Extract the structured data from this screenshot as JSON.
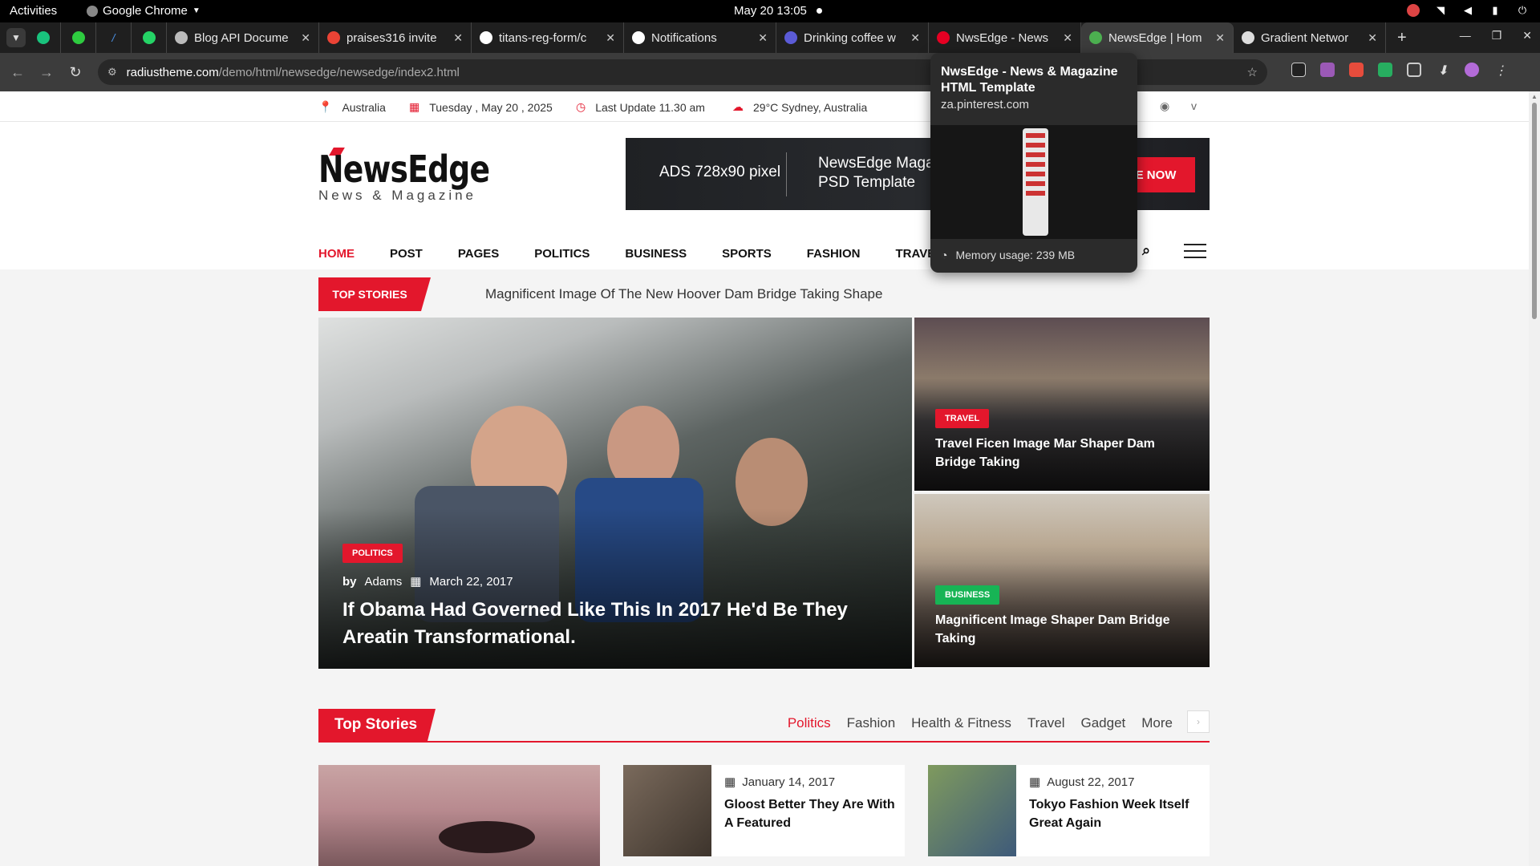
{
  "gnome": {
    "activities": "Activities",
    "app": "Google Chrome",
    "clock": "May 20  13:05"
  },
  "chrome": {
    "tabs": [
      {
        "title": "Blog API Docume",
        "fav_color": "#bbbbbb"
      },
      {
        "title": "praises316 invite",
        "fav_color": "#ea4335"
      },
      {
        "title": "titans-reg-form/c",
        "fav_color": "#ffffff"
      },
      {
        "title": "Notifications",
        "fav_color": "#ffffff"
      },
      {
        "title": "Drinking coffee w",
        "fav_color": "#5b5bd6"
      },
      {
        "title": "NwsEdge - News",
        "fav_color": "#e60023"
      },
      {
        "title": "NewsEdge | Hom",
        "fav_color": "#4caf50",
        "active": true
      },
      {
        "title": "Gradient Networ",
        "fav_color": "#dddddd"
      }
    ],
    "url_host": "radiustheme.com",
    "url_path": "/demo/html/newsedge/newsedge/index2.html",
    "hovercard": {
      "title": "NwsEdge - News & Magazine HTML Template",
      "url": "za.pinterest.com",
      "memory": "Memory usage: 239 MB"
    }
  },
  "site": {
    "topinfo": {
      "country": "Australia",
      "date": "Tuesday , May 20 , 2025",
      "update": "Last Update 11.30 am",
      "weather": "29°C Sydney, Australia"
    },
    "logo": {
      "name": "NewsEdge",
      "tagline": "News & Magazine"
    },
    "ad": {
      "size": "ADS 728x90 pixel",
      "template": "NewsEdge Magazine PSD Template",
      "cta": "E NOW"
    },
    "nav": [
      "HOME",
      "POST",
      "PAGES",
      "POLITICS",
      "BUSINESS",
      "SPORTS",
      "FASHION",
      "TRAVEL"
    ],
    "ticker": {
      "label": "TOP STORIES",
      "text": "Magnificent Image Of The New Hoover Dam Bridge Taking Shape"
    },
    "hero": {
      "category": "POLITICS",
      "by": "by",
      "author": "Adams",
      "date": "March 22, 2017",
      "title": "If Obama Had Governed Like This In 2017 He'd Be They Areatin Transformational."
    },
    "side": [
      {
        "category": "TRAVEL",
        "title": "Travel Ficen Image Mar Shaper Dam Bridge Taking"
      },
      {
        "category": "BUSINESS",
        "title": "Magnificent Image Shaper Dam Bridge Taking"
      }
    ],
    "section": {
      "label": "Top Stories",
      "tabs": [
        "Politics",
        "Fashion",
        "Health & Fitness",
        "Travel",
        "Gadget",
        "More"
      ]
    },
    "cards": [
      {
        "date": "January 14, 2017",
        "title": "Gloost Better They Are With A Featured"
      },
      {
        "date": "August 22, 2017",
        "title": "Tokyo Fashion Week Itself Great Again"
      }
    ]
  },
  "colors": {
    "accent": "#e3172c",
    "business": "#17b455"
  }
}
